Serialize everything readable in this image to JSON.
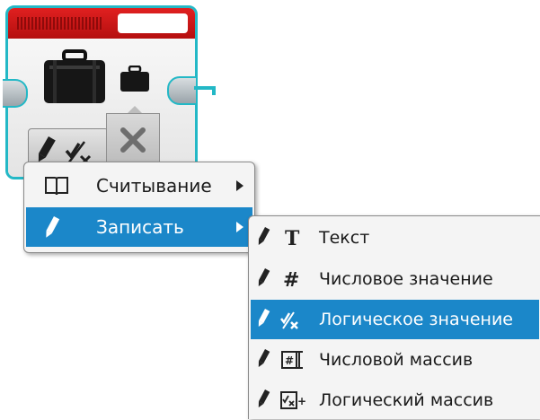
{
  "block": {
    "icon_main": "briefcase-icon",
    "icon_output": "briefcase-icon",
    "mode_icon": "pencil-logic-icon",
    "param_icon": "cross-icon"
  },
  "menu": {
    "items": [
      {
        "label": "Считывание",
        "icon": "book-icon",
        "has_submenu": true,
        "active": false
      },
      {
        "label": "Записать",
        "icon": "pencil-icon",
        "has_submenu": true,
        "active": true
      }
    ]
  },
  "submenu": {
    "items": [
      {
        "label": "Текст",
        "icon": "text-icon",
        "active": false
      },
      {
        "label": "Числовое значение",
        "icon": "number-icon",
        "active": false
      },
      {
        "label": "Логическое значение",
        "icon": "logic-icon",
        "active": true
      },
      {
        "label": "Числовой массив",
        "icon": "number-array-icon",
        "active": false
      },
      {
        "label": "Логический массив",
        "icon": "logic-array-icon",
        "active": false
      }
    ]
  },
  "colors": {
    "accent": "#1b87c9",
    "block_border": "#23b8c6",
    "block_header": "#d41a1a"
  }
}
